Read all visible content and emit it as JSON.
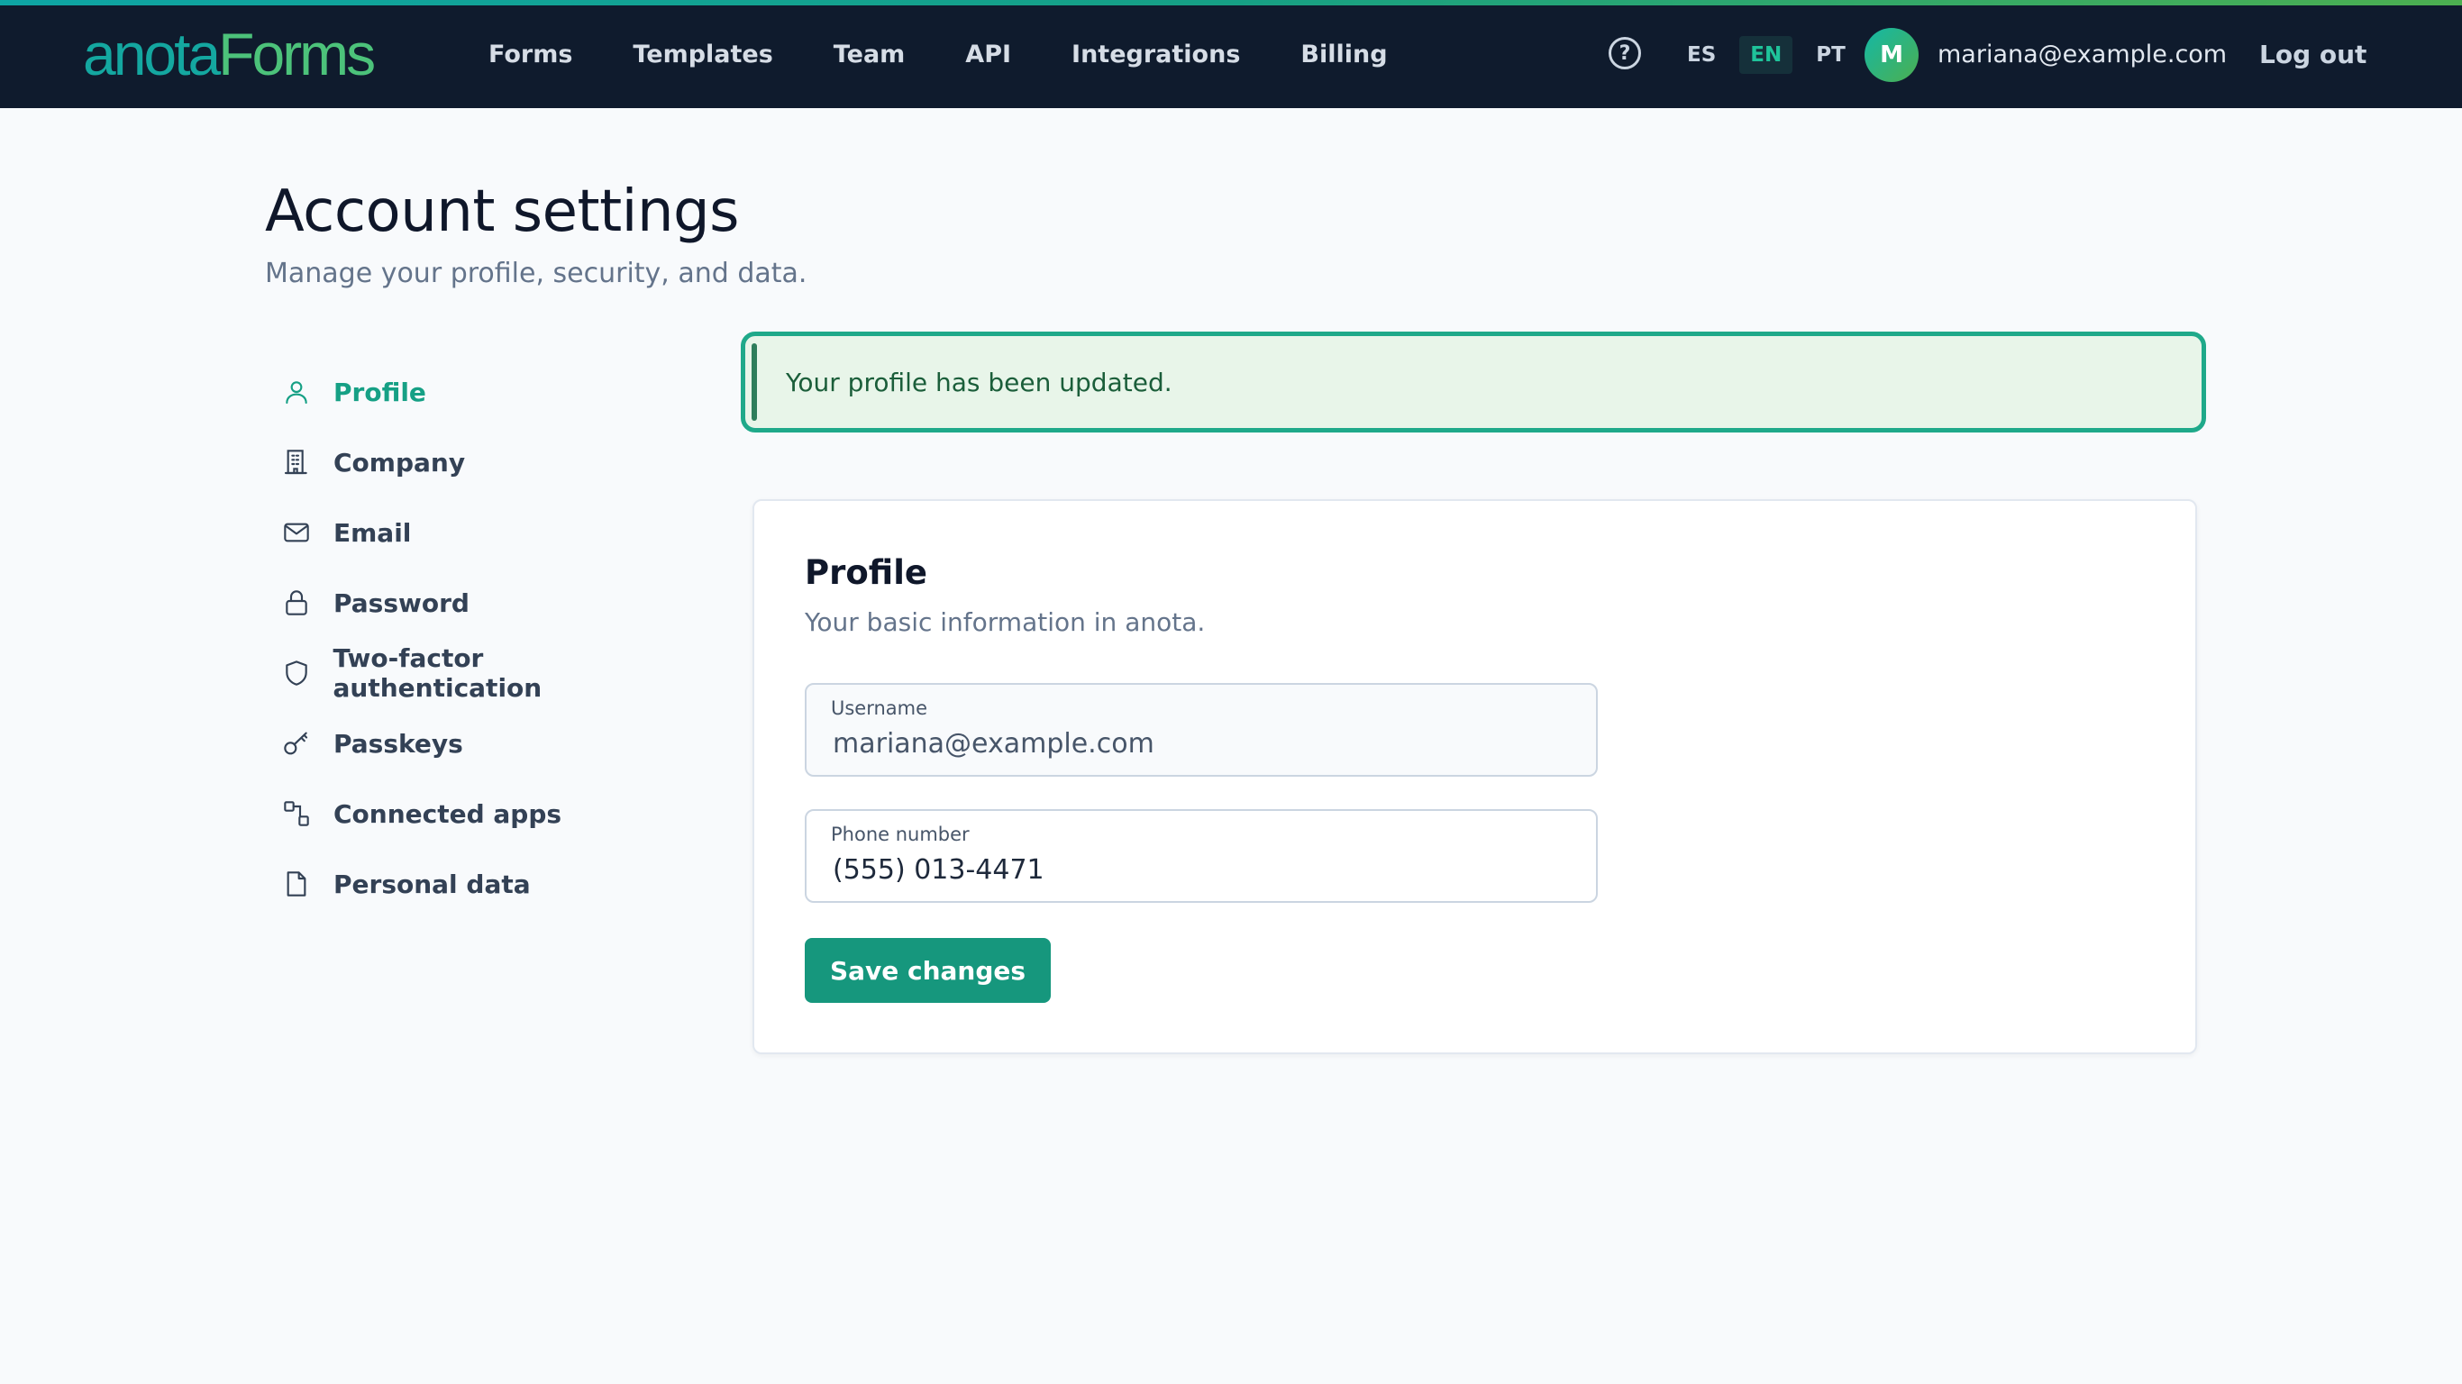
{
  "colors": {
    "accent": "#16a085",
    "topbar": "#0f1b2d",
    "success_bg": "#e8f5e9",
    "success_border": "#1fa98a",
    "button": "#16977d"
  },
  "topbar": {
    "logo_part1": "anota",
    "logo_part2": "Forms",
    "nav": [
      "Forms",
      "Templates",
      "Team",
      "API",
      "Integrations",
      "Billing"
    ],
    "help_icon": "?",
    "languages": [
      {
        "code": "ES",
        "active": false
      },
      {
        "code": "EN",
        "active": true
      },
      {
        "code": "PT",
        "active": false
      }
    ],
    "avatar_initial": "M",
    "user_email": "mariana@example.com",
    "logout_label": "Log out"
  },
  "page": {
    "title": "Account settings",
    "subtitle": "Manage your profile, security, and data."
  },
  "sidebar": {
    "items": [
      {
        "label": "Profile",
        "icon": "user-icon",
        "active": true
      },
      {
        "label": "Company",
        "icon": "building-icon",
        "active": false
      },
      {
        "label": "Email",
        "icon": "mail-icon",
        "active": false
      },
      {
        "label": "Password",
        "icon": "lock-icon",
        "active": false
      },
      {
        "label": "Two-factor authentication",
        "icon": "shield-icon",
        "active": false
      },
      {
        "label": "Passkeys",
        "icon": "key-icon",
        "active": false
      },
      {
        "label": "Connected apps",
        "icon": "apps-icon",
        "active": false
      },
      {
        "label": "Personal data",
        "icon": "document-icon",
        "active": false
      }
    ]
  },
  "alert": {
    "message": "Your profile has been updated."
  },
  "profile_card": {
    "title": "Profile",
    "description": "Your basic information in anota.",
    "username": {
      "label": "Username",
      "value": "mariana@example.com"
    },
    "phone": {
      "label": "Phone number",
      "value": "(555) 013-4471"
    },
    "save_label": "Save changes"
  }
}
